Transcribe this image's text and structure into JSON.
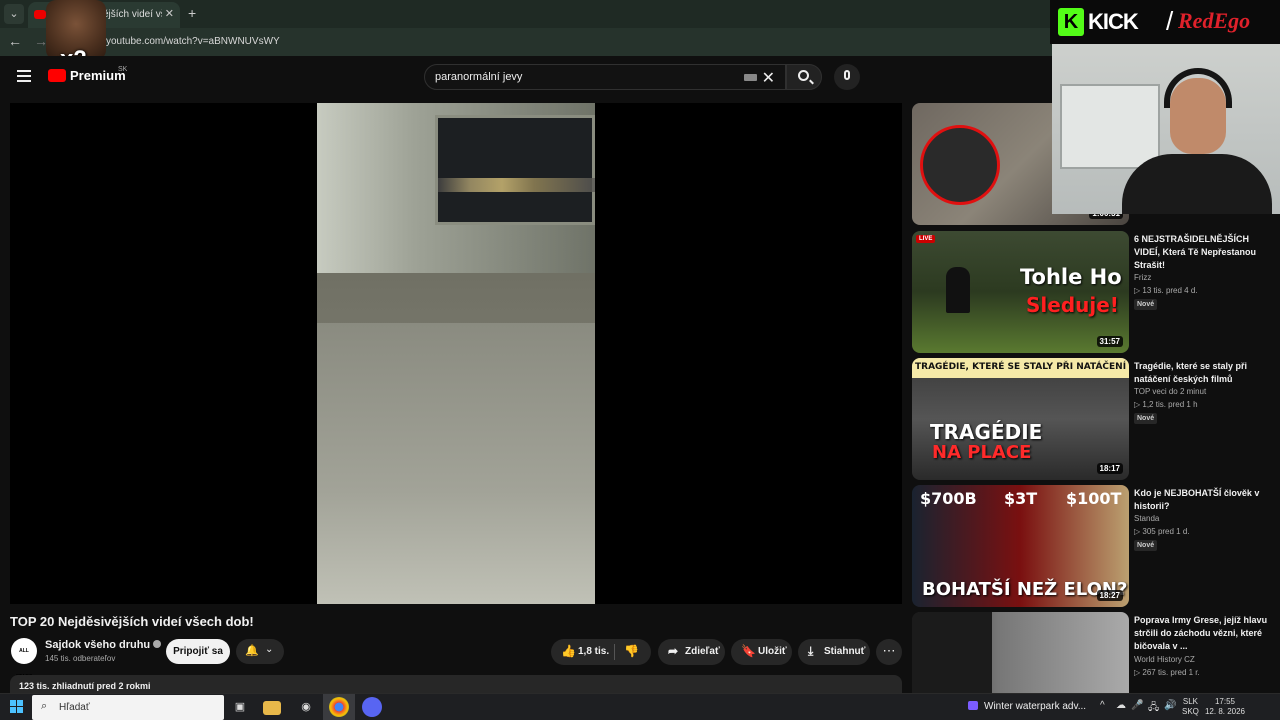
{
  "browser": {
    "tab_title": "vějších videí vš",
    "tab_close": "✕",
    "new_tab": "+",
    "url": "youtube.com/watch?v=aBNWNUVsWY"
  },
  "overlay": {
    "emoji_badge": "x2",
    "kick_letter": "K",
    "kick_word": "KICK",
    "slash": "/",
    "streamer": "RedEgo"
  },
  "header": {
    "logo_text": "Premium",
    "region": "SK",
    "search_value": "paranormální jevy",
    "clear_symbol": "✕"
  },
  "video": {
    "title": "TOP 20 Nejděsivějších videí všech dob!",
    "channel_avatar_text": "ALL STARS",
    "channel_name": "Sajdok všeho druhu",
    "subscribers": "145 tis. odberateľov",
    "join_label": "Pripojiť sa",
    "bell_icon": "🔔",
    "chevron_icon": "⌄",
    "like_count": "1,8 tis.",
    "like_icon": "👍",
    "dislike_icon": "👎",
    "share_label": "Zdieľať",
    "share_icon": "➦",
    "save_label": "Uložiť",
    "save_icon": "🔖",
    "download_label": "Stiahnuť",
    "download_icon": "⤓",
    "more_icon": "⋯",
    "views_date": "123 tis. zhliadnutí  pred 2 rokmi"
  },
  "sidebar": {
    "cards": [
      {
        "duration": "1:00:31",
        "title": "",
        "channel": "",
        "meta": "",
        "badge": ""
      },
      {
        "live": "LIVE",
        "thumb_line1": "Tohle Ho",
        "thumb_line2": "Sleduje!",
        "duration": "31:57",
        "title": "6 NEJSTRAŠIDELNĚJŠÍCH VIDEÍ, Která Tě Nepřestanou Strašit!",
        "channel": "Frizz",
        "meta": "▷ 13 tis.   pred 4 d.",
        "badge": "Nové"
      },
      {
        "thumb_top": "TRAGÉDIE, KTERÉ SE STALY PŘI NATÁČENÍ",
        "thumb_line1": "TRAGÉDIE",
        "thumb_line2": "NA PLACE",
        "duration": "18:17",
        "title": "Tragédie, které se staly při natáčení českých filmů",
        "channel": "TOP veci do 2 minut",
        "meta": "▷ 1,2 tis.   pred 1 h",
        "badge": "Nové"
      },
      {
        "thumb_a": "$700B",
        "thumb_b": "$3T",
        "thumb_c": "$100T",
        "thumb_bottom": "BOHATŠÍ NEŽ ELON?",
        "duration": "18:27",
        "title": "Kdo je NEJBOHATŠÍ člověk v historii?",
        "channel": "Standa",
        "meta": "▷ 305   pred 1 d.",
        "badge": "Nové"
      },
      {
        "title": "Poprava Irmy Grese, jejíž hlavu strčili do záchodu vězni, které bičovala v ...",
        "channel": "World History CZ",
        "meta": "▷ 267 tis.   pred 1 r."
      }
    ]
  },
  "taskbar": {
    "search_placeholder": "Hľadať",
    "news": "Winter waterpark adv...",
    "lang_line1": "SLK",
    "lang_line2": "SKQ",
    "time": "17:55",
    "date": "12. 8. 2026",
    "tray_icons": [
      "^",
      "🎤",
      "🖧",
      "🔊",
      "🔋"
    ]
  },
  "colors": {
    "background": "#0f0f0f",
    "accent_red": "#ff0000",
    "kick_green": "#53fc18",
    "pill": "#272727"
  }
}
